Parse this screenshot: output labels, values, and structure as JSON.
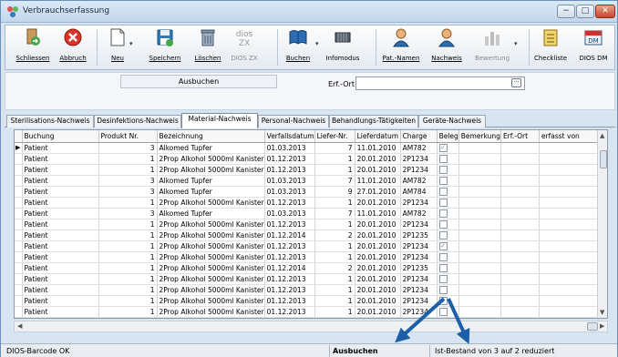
{
  "window": {
    "title": "Verbrauchserfassung",
    "controls": {
      "minimize": "−",
      "maximize": "□",
      "close": "✕"
    }
  },
  "toolbar": [
    {
      "label": "Schliessen",
      "icon": "exit-door-icon",
      "style": "underline"
    },
    {
      "label": "Abbruch",
      "icon": "cancel-x-icon",
      "style": "underline"
    },
    {
      "label": "Neu",
      "icon": "new-document-icon",
      "style": "underline",
      "dropdown": true
    },
    {
      "label": "Speichern",
      "icon": "save-disk-icon",
      "style": "underline"
    },
    {
      "label": "Löschen",
      "icon": "trash-icon",
      "style": "underline"
    },
    {
      "label": "DIOS ZX",
      "icon": "dios-zx-logo-icon",
      "style": "disabled"
    },
    {
      "label": "Buchen",
      "icon": "book-icon",
      "style": "underline",
      "dropdown": true
    },
    {
      "label": "Infomodus",
      "icon": "info-mode-icon",
      "style": "plain"
    },
    {
      "label": "Pat.-Namen",
      "icon": "patient-name-icon",
      "style": "underline"
    },
    {
      "label": "Nachweis",
      "icon": "patient-record-icon",
      "style": "underline"
    },
    {
      "label": "Bewertung",
      "icon": "rating-chart-icon",
      "style": "disabled",
      "dropdown": true
    },
    {
      "label": "Checkliste",
      "icon": "checklist-icon",
      "style": "plain"
    },
    {
      "label": "DIOS DM",
      "icon": "dios-dm-icon",
      "style": "plain"
    }
  ],
  "form": {
    "mode": "Ausbuchen",
    "erf_ort_label": "Erf.-Ort",
    "erf_ort_value": "",
    "erf_ort_button": "···"
  },
  "tabs": [
    {
      "label": "Sterilisations-Nachweis",
      "active": false
    },
    {
      "label": "Desinfektions-Nachweis",
      "active": false
    },
    {
      "label": "Material-Nachweis",
      "active": true
    },
    {
      "label": "Personal-Nachweis",
      "active": false
    },
    {
      "label": "Behandlungs-Tätigkeiten",
      "active": false
    },
    {
      "label": "Geräte-Nachweis",
      "active": false
    }
  ],
  "grid": {
    "row_indicator": "▶",
    "columns": [
      "Buchung",
      "Produkt Nr.",
      "Bezeichnung",
      "Verfallsdatum",
      "Liefer-Nr.",
      "Lieferdatum",
      "Charge",
      "Beleg",
      "Bemerkung",
      "Erf.-Ort",
      "erfasst von"
    ],
    "rows": [
      [
        "Patient",
        "3",
        "Alkomed Tupfer",
        "01.03.2013",
        "7",
        "11.01.2010",
        "AM782",
        true
      ],
      [
        "Patient",
        "1",
        "2Prop Alkohol 5000ml Kanister",
        "01.12.2013",
        "1",
        "20.01.2010",
        "2P1234",
        false
      ],
      [
        "Patient",
        "1",
        "2Prop Alkohol 5000ml Kanister",
        "01.12.2013",
        "1",
        "20.01.2010",
        "2P1234",
        false
      ],
      [
        "Patient",
        "3",
        "Alkomed Tupfer",
        "01.03.2013",
        "7",
        "11.01.2010",
        "AM782",
        false
      ],
      [
        "Patient",
        "3",
        "Alkomed Tupfer",
        "01.03.2013",
        "9",
        "27.01.2010",
        "AM784",
        false
      ],
      [
        "Patient",
        "1",
        "2Prop Alkohol 5000ml Kanister",
        "01.12.2013",
        "1",
        "20.01.2010",
        "2P1234",
        false
      ],
      [
        "Patient",
        "3",
        "Alkomed Tupfer",
        "01.03.2013",
        "7",
        "11.01.2010",
        "AM782",
        false
      ],
      [
        "Patient",
        "1",
        "2Prop Alkohol 5000ml Kanister",
        "01.12.2013",
        "1",
        "20.01.2010",
        "2P1234",
        false
      ],
      [
        "Patient",
        "1",
        "2Prop Alkohol 5000ml Kanister",
        "01.12.2014",
        "2",
        "20.01.2010",
        "2P1235",
        false
      ],
      [
        "Patient",
        "1",
        "2Prop Alkohol 5000ml Kanister",
        "01.12.2013",
        "1",
        "20.01.2010",
        "2P1234",
        true
      ],
      [
        "Patient",
        "1",
        "2Prop Alkohol 5000ml Kanister",
        "01.12.2013",
        "1",
        "20.01.2010",
        "2P1234",
        false
      ],
      [
        "Patient",
        "1",
        "2Prop Alkohol 5000ml Kanister",
        "01.12.2014",
        "2",
        "20.01.2010",
        "2P1235",
        false
      ],
      [
        "Patient",
        "1",
        "2Prop Alkohol 5000ml Kanister",
        "01.12.2013",
        "1",
        "20.01.2010",
        "2P1234",
        false
      ],
      [
        "Patient",
        "1",
        "2Prop Alkohol 5000ml Kanister",
        "01.12.2013",
        "1",
        "20.01.2010",
        "2P1234",
        false
      ],
      [
        "Patient",
        "1",
        "2Prop Alkohol 5000ml Kanister",
        "01.12.2013",
        "1",
        "20.01.2010",
        "2P1234",
        false
      ],
      [
        "Patient",
        "1",
        "2Prop Alkohol 5000ml Kanister",
        "01.12.2013",
        "1",
        "20.01.2010",
        "2P1234",
        false
      ]
    ]
  },
  "statusbar": {
    "left": "DIOS-Barcode OK",
    "middle": "Ausbuchen",
    "right": "Ist-Bestand von 3 auf 2 reduziert"
  },
  "colors": {
    "annotation_arrows": "#1b5fa8",
    "window_frame": "#6b8fb8",
    "titlebar": "#c2d6ec"
  }
}
